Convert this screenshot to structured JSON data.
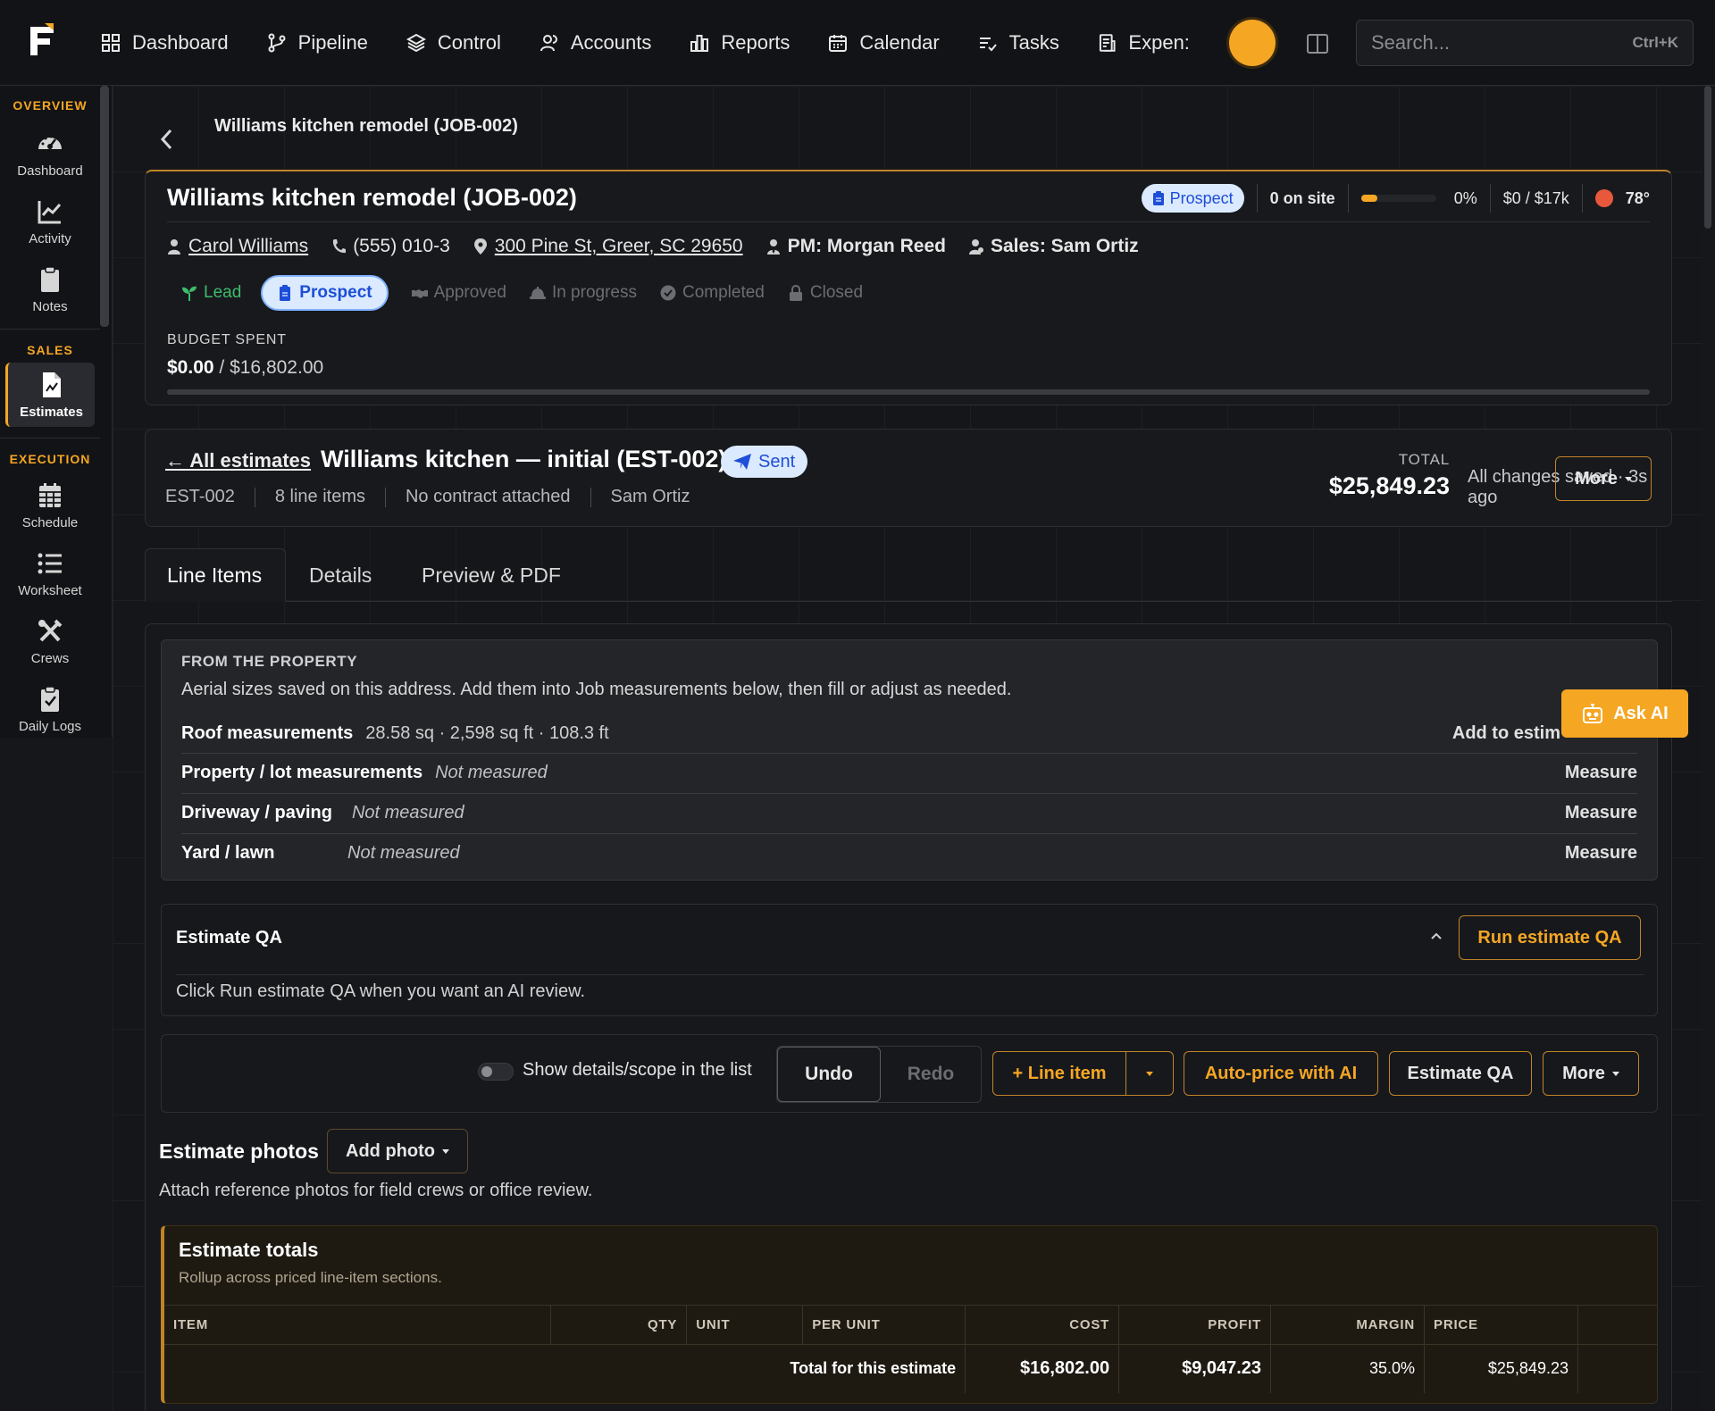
{
  "nav": {
    "items": [
      {
        "label": "Dashboard",
        "icon": "grid-icon"
      },
      {
        "label": "Pipeline",
        "icon": "pipeline-icon"
      },
      {
        "label": "Control",
        "icon": "layers-icon"
      },
      {
        "label": "Accounts",
        "icon": "users-icon"
      },
      {
        "label": "Reports",
        "icon": "bar-chart-icon"
      },
      {
        "label": "Calendar",
        "icon": "calendar-icon"
      },
      {
        "label": "Tasks",
        "icon": "tasks-icon"
      },
      {
        "label": "Expen:",
        "icon": "receipt-icon"
      }
    ],
    "search_placeholder": "Search...",
    "search_shortcut": "Ctrl+K"
  },
  "sidebar": {
    "overview_label": "OVERVIEW",
    "sales_label": "SALES",
    "execution_label": "EXECUTION",
    "items": [
      {
        "label": "Dashboard",
        "icon": "gauge-icon"
      },
      {
        "label": "Activity",
        "icon": "activity-chart-icon"
      },
      {
        "label": "Notes",
        "icon": "clipboard-icon"
      },
      {
        "label": "Estimates",
        "icon": "estimate-doc-icon",
        "active": true
      },
      {
        "label": "Schedule",
        "icon": "calendar-grid-icon"
      },
      {
        "label": "Worksheet",
        "icon": "list-icon"
      },
      {
        "label": "Crews",
        "icon": "tools-icon"
      },
      {
        "label": "Daily Logs",
        "icon": "clipboard-check-icon"
      }
    ]
  },
  "breadcrumb": "Williams kitchen remodel (JOB-002)",
  "job": {
    "title": "Williams kitchen remodel (JOB-002)",
    "status": "Prospect",
    "on_site": "0 on site",
    "progress_text": "0%",
    "progress_fraction": 0,
    "budget_short": "$0 / $17k",
    "weather": "78°",
    "customer": "Carol Williams",
    "phone": "(555) 010-3",
    "address": "300 Pine St, Greer, SC 29650",
    "pm": "PM: Morgan Reed",
    "sales": "Sales: Sam Ortiz",
    "stages": [
      "Lead",
      "Prospect",
      "Approved",
      "In progress",
      "Completed",
      "Closed"
    ],
    "budget_label": "BUDGET SPENT",
    "budget_spent": "$0.00",
    "budget_total": "/ $16,802.00",
    "budget_fraction": 0
  },
  "estimate": {
    "back_label": "← All estimates",
    "title": "Williams kitchen — initial (EST-002)",
    "status": "Sent",
    "meta": [
      "EST-002",
      "8 line items",
      "No contract attached",
      "Sam Ortiz"
    ],
    "total_label": "TOTAL",
    "total_value": "$25,849.23",
    "saved_text": "All changes saved · 3s ago",
    "more_label": "More"
  },
  "tabs": [
    "Line Items",
    "Details",
    "Preview & PDF"
  ],
  "property": {
    "heading": "FROM THE PROPERTY",
    "description": "Aerial sizes saved on this address. Add them into Job measurements below, then fill or adjust as needed.",
    "rows": [
      {
        "name": "Roof measurements",
        "value": "28.58 sq · 2,598 sq ft · 108.3 ft",
        "action": "Add to estim"
      },
      {
        "name": "Property / lot measurements",
        "value": "Not measured",
        "action": "Measure"
      },
      {
        "name": "Driveway / paving",
        "value": "Not measured",
        "action": "Measure"
      },
      {
        "name": "Yard / lawn",
        "value": "Not measured",
        "action": "Measure"
      }
    ]
  },
  "ask_ai": "Ask AI",
  "qa": {
    "title": "Estimate QA",
    "run_label": "Run estimate QA",
    "description": "Click Run estimate QA when you want an AI review."
  },
  "toolbar": {
    "toggle_label": "Show details/scope in the list",
    "undo": "Undo",
    "redo": "Redo",
    "line_item": "+ Line item",
    "auto_price": "Auto-price with AI",
    "estimate_qa": "Estimate QA",
    "more": "More"
  },
  "photos": {
    "title": "Estimate photos",
    "add_label": "Add photo",
    "description": "Attach reference photos for field crews or office review."
  },
  "totals": {
    "title": "Estimate totals",
    "subtitle": "Rollup across priced line-item sections.",
    "columns": [
      "ITEM",
      "QTY",
      "UNIT",
      "PER UNIT",
      "COST",
      "PROFIT",
      "MARGIN",
      "PRICE"
    ],
    "row": {
      "label": "Total for this estimate",
      "cost": "$16,802.00",
      "profit": "$9,047.23",
      "margin": "35.0%",
      "price": "$25,849.23"
    }
  },
  "colors": {
    "accent": "#f5a623",
    "prospect_bg": "#dbeafe",
    "prospect_text": "#1d4ed8",
    "lead_green": "#3dbb6b"
  }
}
